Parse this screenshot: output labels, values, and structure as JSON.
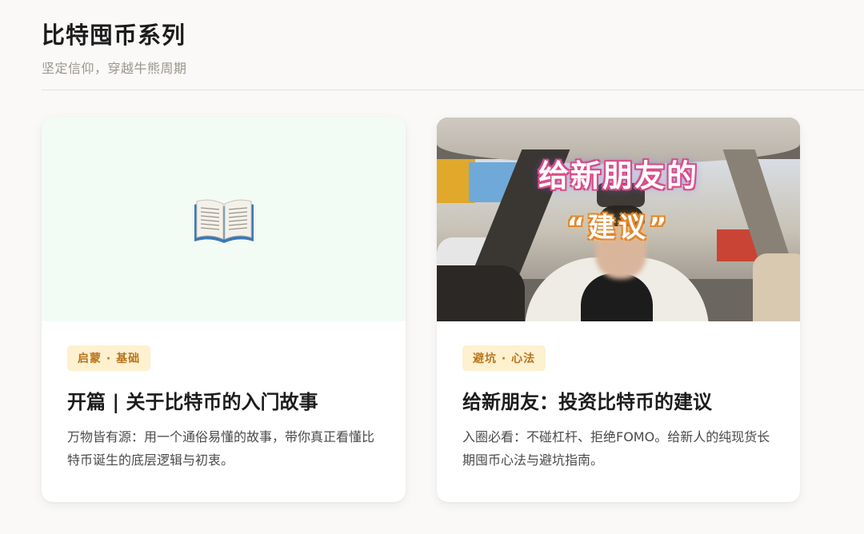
{
  "header": {
    "title": "比特囤币系列",
    "subtitle": "坚定信仰，穿越牛熊周期"
  },
  "cards": [
    {
      "cover_icon": "open-book-icon",
      "cover_bg": "#f3fbf5",
      "tag": "启蒙 · 基础",
      "title": "开篇 | 关于比特币的入门故事",
      "description": "万物皆有源：用一个通俗易懂的故事，带你真正看懂比特币诞生的底层逻辑与初衷。"
    },
    {
      "cover_overlay_line1": "给新朋友的",
      "cover_overlay_line2": "“建议”",
      "tag": "避坑 · 心法",
      "title": "给新朋友：投资比特币的建议",
      "description": "入圈必看：不碰杠杆、拒绝FOMO。给新人的纯现货长期囤币心法与避坑指南。"
    }
  ],
  "colors": {
    "background": "#faf9f7",
    "tag_bg": "#fdf1cf",
    "tag_text": "#b8741d",
    "subtitle": "#9a958d"
  }
}
